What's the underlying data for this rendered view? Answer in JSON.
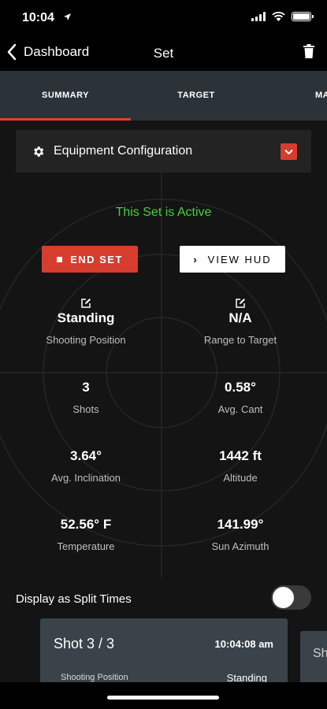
{
  "status_bar": {
    "time": "10:04",
    "location_icon": "location-arrow-icon"
  },
  "nav": {
    "back_label": "Dashboard",
    "title": "Set",
    "back_icon": "chevron-left-icon",
    "delete_icon": "trash-icon"
  },
  "tabs": [
    {
      "label": "SUMMARY",
      "active": true
    },
    {
      "label": "TARGET",
      "active": false
    },
    {
      "label": "MA",
      "active": false
    }
  ],
  "equipment": {
    "label": "Equipment Configuration",
    "icon": "gear-icon"
  },
  "status_text": "This Set is Active",
  "actions": {
    "end_set": "END SET",
    "view_hud": "VIEW HUD"
  },
  "stats": [
    {
      "value": "Standing",
      "label": "Shooting Position",
      "editable": true
    },
    {
      "value": "N/A",
      "label": "Range to Target",
      "editable": true
    },
    {
      "value": "3",
      "label": "Shots",
      "editable": false
    },
    {
      "value": "0.58°",
      "label": "Avg. Cant",
      "editable": false
    },
    {
      "value": "3.64°",
      "label": "Avg. Inclination",
      "editable": false
    },
    {
      "value": "1442 ft",
      "label": "Altitude",
      "editable": false
    },
    {
      "value": "52.56° F",
      "label": "Temperature",
      "editable": false
    },
    {
      "value": "141.99°",
      "label": "Sun Azimuth",
      "editable": false
    }
  ],
  "split_times": {
    "label": "Display as Split Times",
    "enabled": false
  },
  "shots": [
    {
      "title": "Shot 3 / 3",
      "time": "10:04:08 am",
      "position_label": "Shooting Position",
      "position_value": "Standing"
    },
    {
      "title": "Sh"
    }
  ],
  "colors": {
    "accent": "#e23e2f",
    "active_green": "#3fd23a",
    "card_bg": "#394349",
    "tab_bg": "#2c3338"
  }
}
